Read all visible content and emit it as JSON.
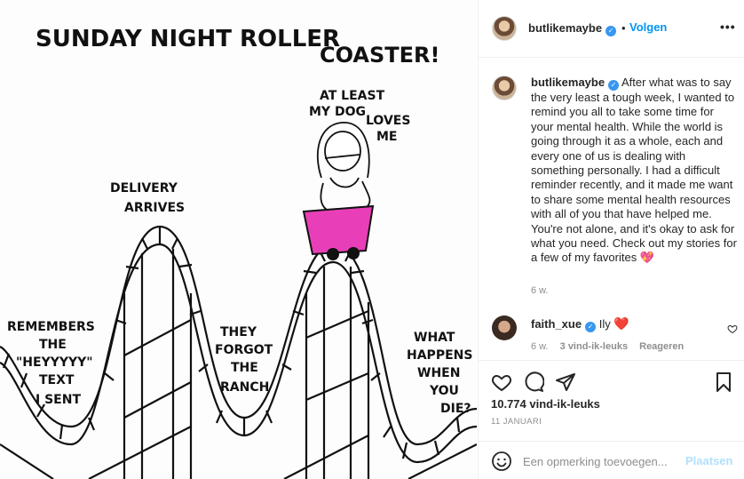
{
  "header": {
    "username": "butlikemaybe",
    "separator": "•",
    "follow_label": "Volgen",
    "more_label": "•••"
  },
  "image": {
    "title": "SUNDAY NIGHT ROLLER",
    "title2": "COASTER!",
    "dog_line1": "AT LEAST",
    "dog_line2": "MY DOG",
    "dog_line3": "LOVES",
    "dog_line4": "ME",
    "delivery_line1": "DELIVERY",
    "delivery_line2": "ARRIVES",
    "remembers_line1": "REMEMBERS",
    "remembers_line2": "THE",
    "remembers_line3": "\"HEYYYYY\"",
    "remembers_line4": "TEXT",
    "remembers_line5": "I SENT",
    "ranch_line1": "THEY",
    "ranch_line2": "FORGOT",
    "ranch_line3": "THE",
    "ranch_line4": "RANCH",
    "die_line1": "WHAT",
    "die_line2": "HAPPENS",
    "die_line3": "WHEN",
    "die_line4": "YOU",
    "die_line5": "DIE?"
  },
  "caption": {
    "username": "butlikemaybe",
    "text": "After what was to say the very least a tough week, I wanted to remind you all to take some time for your mental health. While the world is going through it as a whole, each and every one of us is dealing with something personally. I had a difficult reminder recently, and it made me want to share some mental health resources with all of you that have helped me. You're not alone, and it's okay to ask for what you need. Check out my stories for a few of my favorites",
    "emoji": "💖",
    "time": "6 w."
  },
  "comment": {
    "username": "faith_xue",
    "text": "Ily",
    "emoji": "❤️",
    "time": "6 w.",
    "likes": "3 vind-ik-leuks",
    "reply_label": "Reageren"
  },
  "actions": {
    "likes": "10.774 vind-ik-leuks",
    "date": "11 JANUARI"
  },
  "add_comment": {
    "placeholder": "Een opmerking toevoegen...",
    "post_label": "Plaatsen"
  },
  "colors": {
    "accent": "#0095f6",
    "verified": "#3897f0",
    "cart": "#e83fb8",
    "post_disabled": "#b2dffc"
  }
}
